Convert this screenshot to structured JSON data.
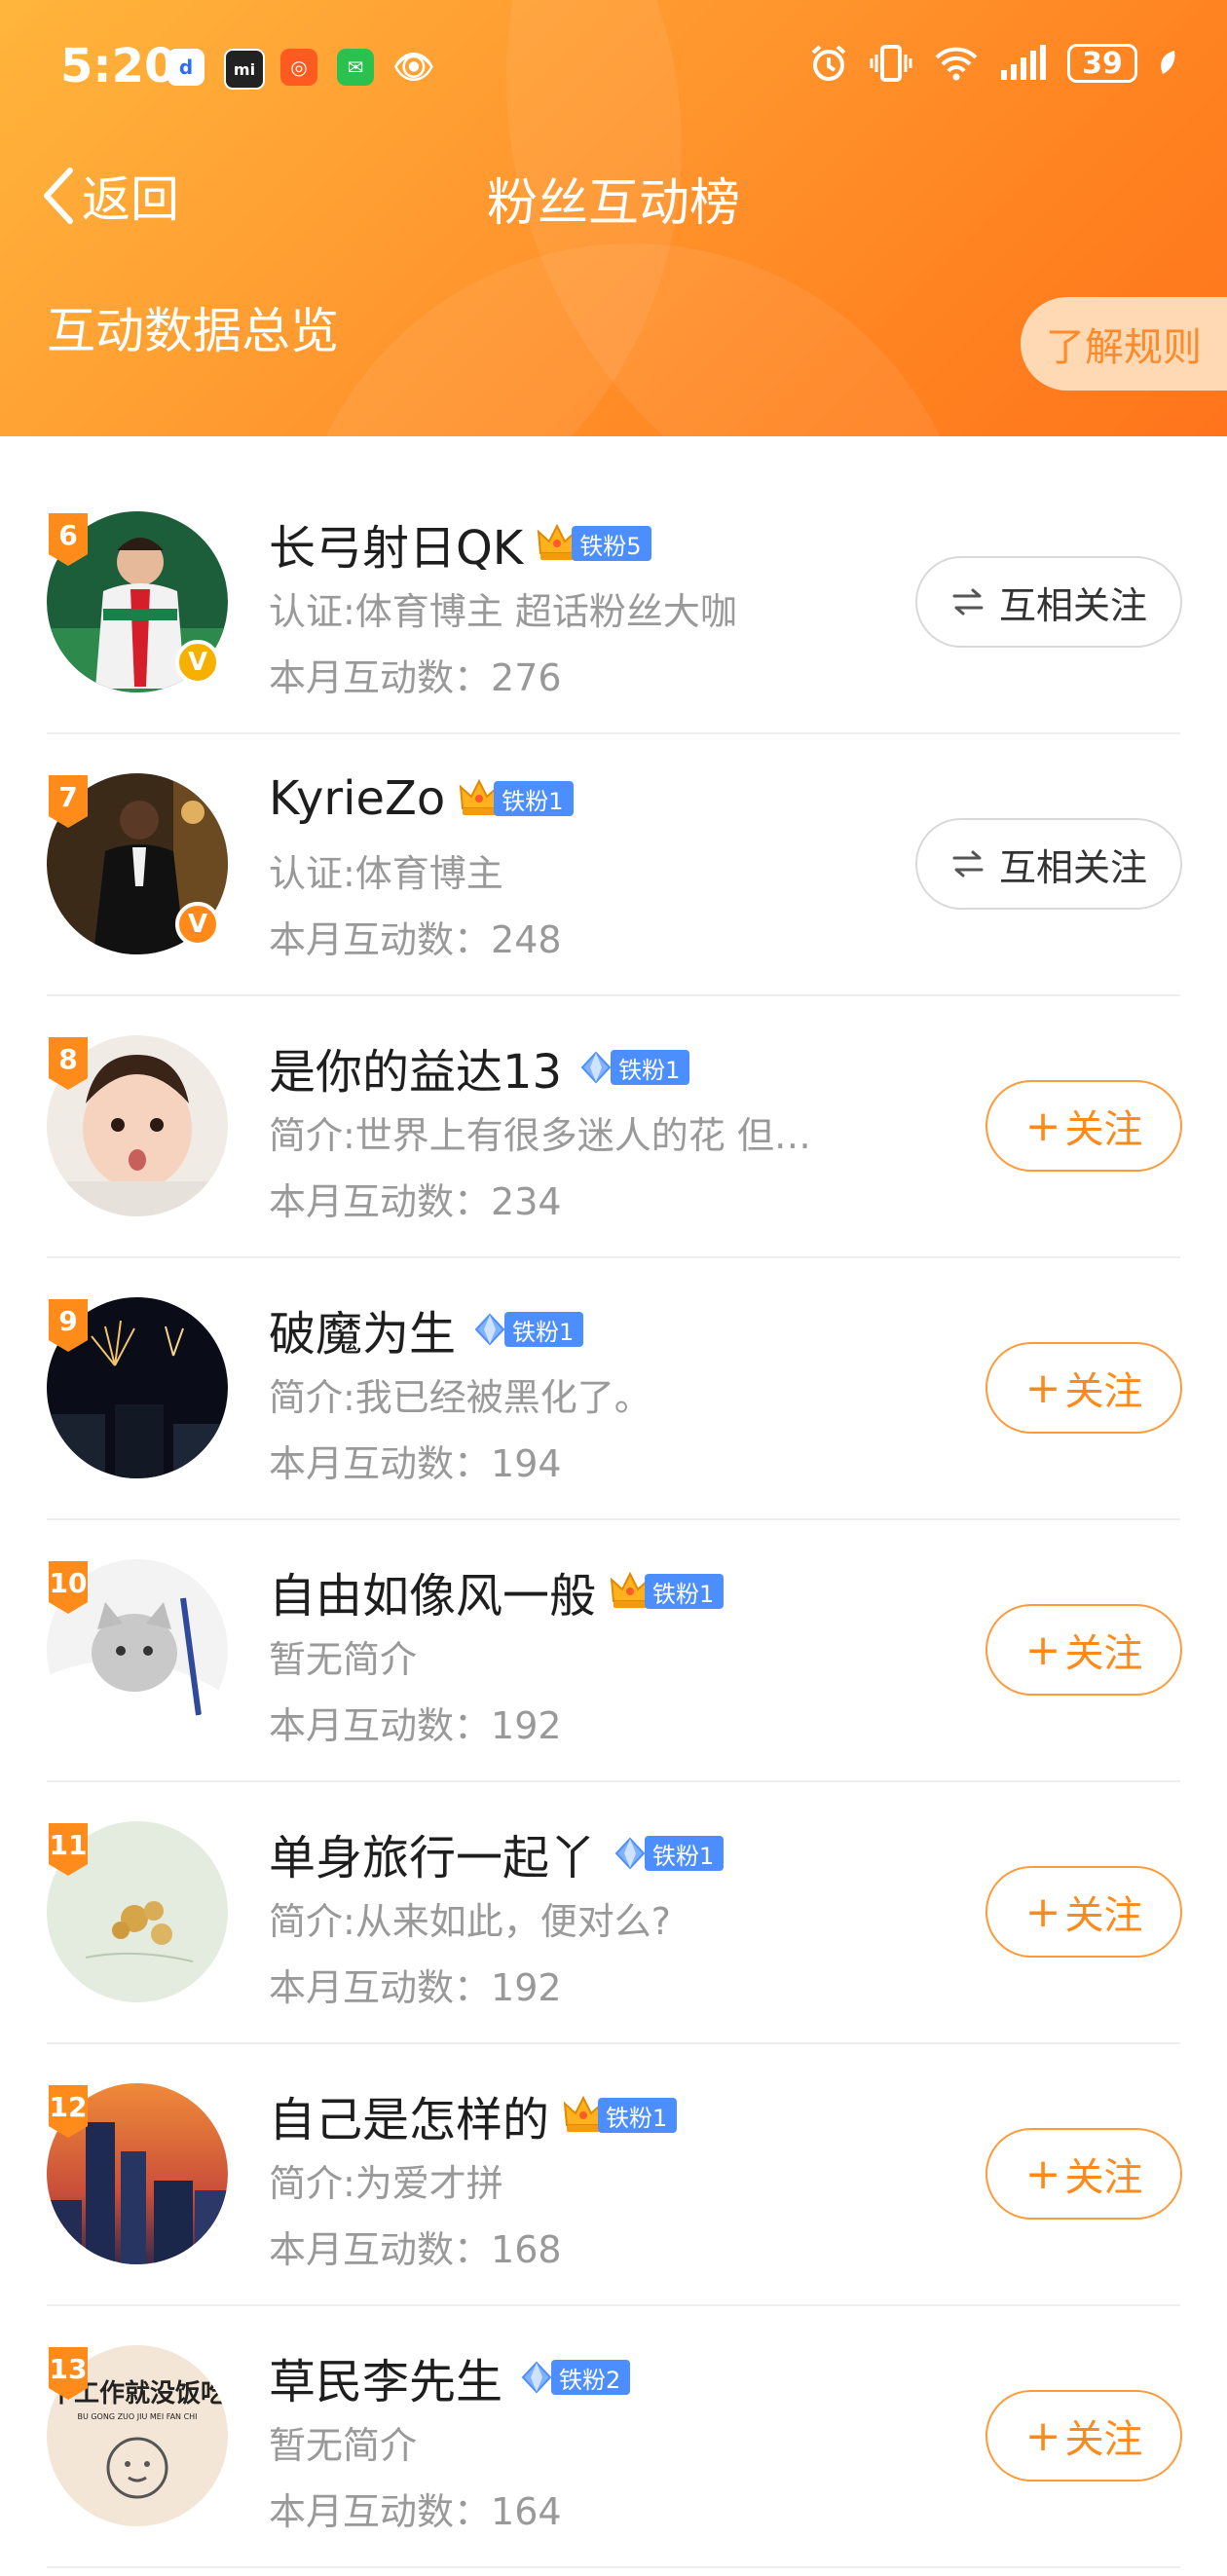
{
  "status_bar": {
    "time": "5:20",
    "battery": "39",
    "app_icons": [
      "du-app-icon",
      "mi-app-icon",
      "camera-app-icon",
      "wechat-icon",
      "eye-icon"
    ]
  },
  "nav": {
    "back_label": "返回",
    "title": "粉丝互动榜"
  },
  "header": {
    "overview_label": "互动数据总览",
    "rules_button": "了解规则"
  },
  "colors": {
    "header_start": "#ffb02e",
    "header_end": "#ff6a0a",
    "accent": "#ff8a1a",
    "badge_blue": "#4d8eff"
  },
  "count_prefix": "本月互动数：",
  "fans": [
    {
      "rank": "6",
      "name": "长弓射日QK",
      "badge_icon": "crown-icon",
      "badge": "铁粉5",
      "desc": "认证:体育博主 超话粉丝大咖",
      "count": "276",
      "button": "互相关注",
      "button_type": "mutual",
      "verified": "gold"
    },
    {
      "rank": "7",
      "name": "KyrieZo",
      "badge_icon": "crown-icon",
      "badge": "铁粉1",
      "desc": "认证:体育博主",
      "count": "248",
      "button": "互相关注",
      "button_type": "mutual",
      "verified": "orange"
    },
    {
      "rank": "8",
      "name": "是你的益达13",
      "badge_icon": "diamond-icon",
      "badge": "铁粉1",
      "desc": "简介:世界上有很多迷人的花 但…",
      "count": "234",
      "button": "关注",
      "button_type": "follow",
      "verified": ""
    },
    {
      "rank": "9",
      "name": "破魔为生",
      "badge_icon": "diamond-icon",
      "badge": "铁粉1",
      "desc": "简介:我已经被黑化了。",
      "count": "194",
      "button": "关注",
      "button_type": "follow",
      "verified": ""
    },
    {
      "rank": "10",
      "name": "自由如像风一般",
      "badge_icon": "crown-icon",
      "badge": "铁粉1",
      "desc": "暂无简介",
      "count": "192",
      "button": "关注",
      "button_type": "follow",
      "verified": ""
    },
    {
      "rank": "11",
      "name": "单身旅行一起丫",
      "badge_icon": "diamond-icon",
      "badge": "铁粉1",
      "desc": "简介:从来如此，便对么?",
      "count": "192",
      "button": "关注",
      "button_type": "follow",
      "verified": ""
    },
    {
      "rank": "12",
      "name": "自己是怎样的",
      "badge_icon": "crown-icon",
      "badge": "铁粉1",
      "desc": "简介:为爱才拼",
      "count": "168",
      "button": "关注",
      "button_type": "follow",
      "verified": ""
    },
    {
      "rank": "13",
      "name": "草民李先生",
      "badge_icon": "diamond-icon",
      "badge": "铁粉2",
      "desc": "暂无简介",
      "count": "164",
      "button": "关注",
      "button_type": "follow",
      "verified": ""
    }
  ],
  "avatar_logo_13": {
    "line1": "不工作就没饭吃",
    "line2": "BU GONG ZUO JIU MEI FAN CHI"
  }
}
